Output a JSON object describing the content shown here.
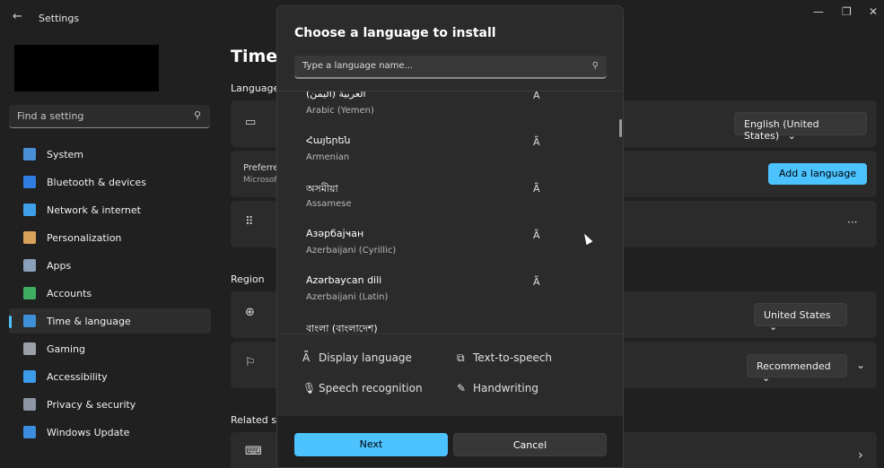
{
  "window": {
    "title": "Settings",
    "back_icon": "←",
    "minimize_icon": "—",
    "restore_icon": "❐",
    "close_icon": "✕"
  },
  "sidebar": {
    "search_placeholder": "Find a setting",
    "search_icon": "⚲",
    "items": [
      {
        "label": "System",
        "color": "#4a8ed8"
      },
      {
        "label": "Bluetooth & devices",
        "color": "#2f7de1"
      },
      {
        "label": "Network & internet",
        "color": "#3ea0e8"
      },
      {
        "label": "Personalization",
        "color": "#d9a25a"
      },
      {
        "label": "Apps",
        "color": "#8aa0b8"
      },
      {
        "label": "Accounts",
        "color": "#3fae62"
      },
      {
        "label": "Time & language",
        "color": "#3d8fd8"
      },
      {
        "label": "Gaming",
        "color": "#9aa0a8"
      },
      {
        "label": "Accessibility",
        "color": "#3c9ae8"
      },
      {
        "label": "Privacy & security",
        "color": "#8c96a4"
      },
      {
        "label": "Windows Update",
        "color": "#3c8ce0"
      }
    ]
  },
  "main": {
    "title": "Time",
    "sections": {
      "language": "Language",
      "region": "Region",
      "related": "Related se"
    },
    "display_language_dd": "English (United States)",
    "preferred_label": "Preferre",
    "preferred_sub": "Microsof",
    "add_language": "Add a language",
    "more_icon": "···",
    "country_dd": "United States",
    "regional_format_dd": "Recommended",
    "chevron_down": "⌄",
    "chevron_right": "›"
  },
  "modal": {
    "title": "Choose a language to install",
    "search_placeholder": "Type a language name...",
    "search_icon": "⚲",
    "languages": [
      {
        "native": "العربية (اليمن)",
        "english": "Arabic (Yemen)"
      },
      {
        "native": "Հայերեն",
        "english": "Armenian"
      },
      {
        "native": "অসমীয়া",
        "english": "Assamese"
      },
      {
        "native": "Азәрбајҹан",
        "english": "Azerbaijani (Cyrillic)"
      },
      {
        "native": "Azərbaycan dili",
        "english": "Azerbaijani (Latin)"
      },
      {
        "native": "বাংলা (বাংলাদেশ)",
        "english": ""
      }
    ],
    "feature_glyph": "A͆",
    "features": [
      {
        "icon": "A͆",
        "label": "Display language"
      },
      {
        "icon": "⧉",
        "label": "Text-to-speech"
      },
      {
        "icon": "🎙",
        "label": "Speech recognition"
      },
      {
        "icon": "✎",
        "label": "Handwriting"
      }
    ],
    "next": "Next",
    "cancel": "Cancel"
  }
}
